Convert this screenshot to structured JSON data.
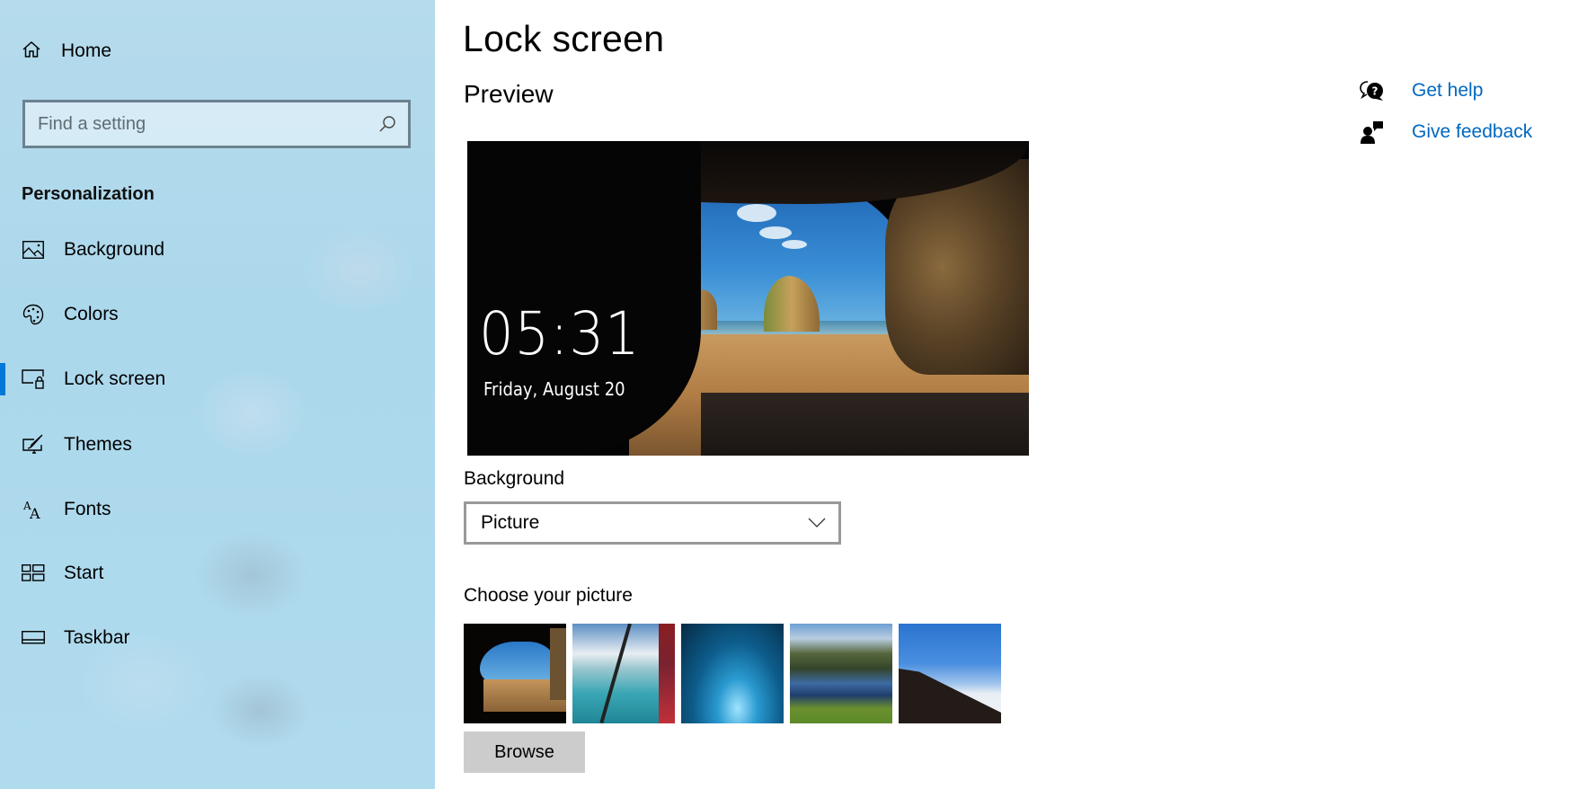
{
  "sidebar": {
    "home_label": "Home",
    "search": {
      "placeholder": "Find a setting",
      "value": ""
    },
    "section_title": "Personalization",
    "items": [
      {
        "label": "Background",
        "icon": "picture-icon",
        "selected": false
      },
      {
        "label": "Colors",
        "icon": "palette-icon",
        "selected": false
      },
      {
        "label": "Lock screen",
        "icon": "lock-screen-icon",
        "selected": true
      },
      {
        "label": "Themes",
        "icon": "themes-icon",
        "selected": false
      },
      {
        "label": "Fonts",
        "icon": "fonts-icon",
        "selected": false
      },
      {
        "label": "Start",
        "icon": "start-icon",
        "selected": false
      },
      {
        "label": "Taskbar",
        "icon": "taskbar-icon",
        "selected": false
      }
    ],
    "accent_color": "#0078d7"
  },
  "main": {
    "title": "Lock screen",
    "preview_heading": "Preview",
    "preview": {
      "time": "05:31",
      "date": "Friday, August 20"
    },
    "background_label": "Background",
    "background_dropdown": {
      "selected": "Picture"
    },
    "choose_picture_label": "Choose your picture",
    "pictures": [
      {
        "name": "sea-cave-beach"
      },
      {
        "name": "aerial-coast-from-plane"
      },
      {
        "name": "blue-ice-cave"
      },
      {
        "name": "mountain-lake-reflection"
      },
      {
        "name": "hiker-above-clouds"
      }
    ],
    "browse_label": "Browse"
  },
  "side_links": {
    "get_help": "Get help",
    "give_feedback": "Give feedback",
    "link_color": "#0067c0"
  }
}
